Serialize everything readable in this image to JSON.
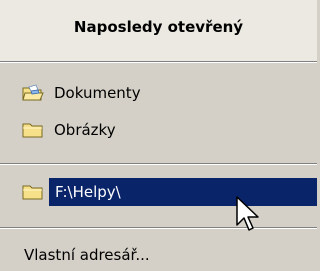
{
  "header": {
    "title": "Naposledy otevřený"
  },
  "items": [
    {
      "label": "Dokumenty",
      "icon": "open-folder-icon"
    },
    {
      "label": "Obrázky",
      "icon": "folder-icon"
    }
  ],
  "selected": {
    "label": "F:\\Helpy\\",
    "icon": "folder-icon"
  },
  "custom": {
    "label": "Vlastní adresář..."
  },
  "colors": {
    "background": "#d4d0c8",
    "header_background": "#ece9e2",
    "selection": "#0a246a",
    "folder_yellow": "#f6e08a"
  }
}
